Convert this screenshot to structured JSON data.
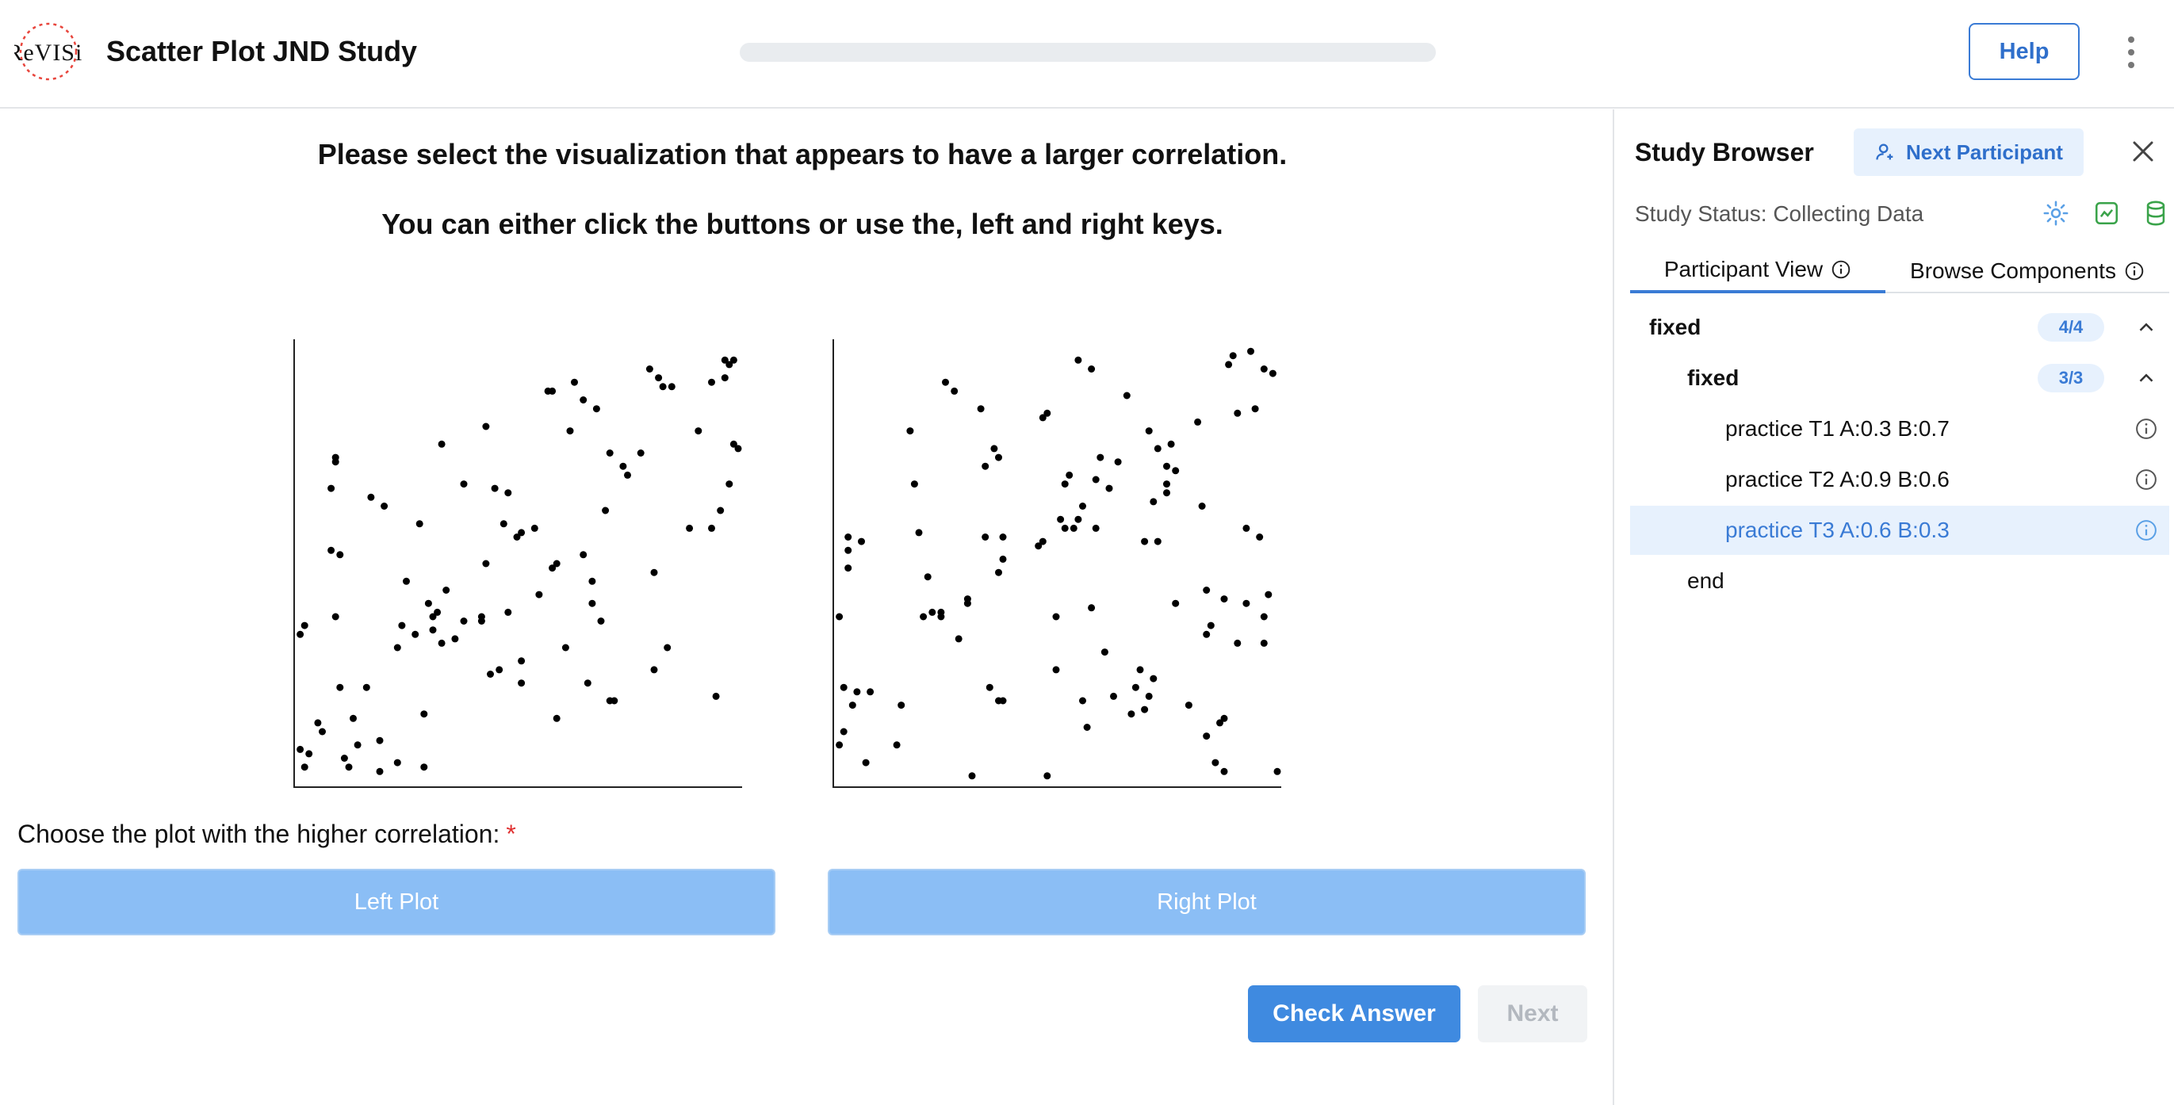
{
  "header": {
    "title": "Scatter Plot JND Study",
    "help_label": "Help",
    "progress": 0
  },
  "main": {
    "prompt_line1": "Please select the visualization that appears to have a larger correlation.",
    "prompt_line2": "You can either click the buttons or use the, left and right keys.",
    "question": "Choose the plot with the higher correlation:",
    "required_mark": "*",
    "left_choice_label": "Left Plot",
    "right_choice_label": "Right Plot",
    "check_answer_label": "Check Answer",
    "next_label": "Next"
  },
  "chart_data": [
    {
      "type": "scatter",
      "name": "",
      "xlim": [
        0,
        1
      ],
      "ylim": [
        0,
        1
      ],
      "grid": false,
      "points": [
        [
          0.01,
          0.34
        ],
        [
          0.02,
          0.36
        ],
        [
          0.01,
          0.08
        ],
        [
          0.03,
          0.07
        ],
        [
          0.02,
          0.04
        ],
        [
          0.05,
          0.14
        ],
        [
          0.06,
          0.12
        ],
        [
          0.08,
          0.53
        ],
        [
          0.09,
          0.73
        ],
        [
          0.08,
          0.67
        ],
        [
          0.09,
          0.74
        ],
        [
          0.1,
          0.52
        ],
        [
          0.09,
          0.38
        ],
        [
          0.1,
          0.22
        ],
        [
          0.12,
          0.04
        ],
        [
          0.11,
          0.06
        ],
        [
          0.13,
          0.15
        ],
        [
          0.14,
          0.09
        ],
        [
          0.16,
          0.22
        ],
        [
          0.17,
          0.65
        ],
        [
          0.19,
          0.1
        ],
        [
          0.2,
          0.63
        ],
        [
          0.19,
          0.03
        ],
        [
          0.23,
          0.31
        ],
        [
          0.25,
          0.46
        ],
        [
          0.23,
          0.05
        ],
        [
          0.24,
          0.36
        ],
        [
          0.28,
          0.59
        ],
        [
          0.29,
          0.04
        ],
        [
          0.29,
          0.16
        ],
        [
          0.27,
          0.34
        ],
        [
          0.31,
          0.35
        ],
        [
          0.3,
          0.41
        ],
        [
          0.31,
          0.38
        ],
        [
          0.33,
          0.32
        ],
        [
          0.32,
          0.39
        ],
        [
          0.34,
          0.44
        ],
        [
          0.33,
          0.77
        ],
        [
          0.36,
          0.33
        ],
        [
          0.38,
          0.37
        ],
        [
          0.38,
          0.68
        ],
        [
          0.42,
          0.38
        ],
        [
          0.42,
          0.37
        ],
        [
          0.43,
          0.81
        ],
        [
          0.43,
          0.5
        ],
        [
          0.44,
          0.25
        ],
        [
          0.45,
          0.67
        ],
        [
          0.46,
          0.26
        ],
        [
          0.47,
          0.59
        ],
        [
          0.48,
          0.66
        ],
        [
          0.48,
          0.39
        ],
        [
          0.5,
          0.56
        ],
        [
          0.51,
          0.57
        ],
        [
          0.51,
          0.28
        ],
        [
          0.51,
          0.23
        ],
        [
          0.54,
          0.58
        ],
        [
          0.55,
          0.43
        ],
        [
          0.57,
          0.89
        ],
        [
          0.58,
          0.49
        ],
        [
          0.59,
          0.5
        ],
        [
          0.59,
          0.15
        ],
        [
          0.58,
          0.89
        ],
        [
          0.61,
          0.31
        ],
        [
          0.62,
          0.8
        ],
        [
          0.63,
          0.91
        ],
        [
          0.65,
          0.87
        ],
        [
          0.65,
          0.52
        ],
        [
          0.66,
          0.23
        ],
        [
          0.67,
          0.46
        ],
        [
          0.67,
          0.41
        ],
        [
          0.68,
          0.85
        ],
        [
          0.69,
          0.37
        ],
        [
          0.7,
          0.62
        ],
        [
          0.71,
          0.75
        ],
        [
          0.71,
          0.19
        ],
        [
          0.72,
          0.19
        ],
        [
          0.74,
          0.72
        ],
        [
          0.75,
          0.7
        ],
        [
          0.78,
          0.75
        ],
        [
          0.8,
          0.94
        ],
        [
          0.81,
          0.48
        ],
        [
          0.81,
          0.26
        ],
        [
          0.82,
          0.92
        ],
        [
          0.83,
          0.9
        ],
        [
          0.84,
          0.31
        ],
        [
          0.85,
          0.9
        ],
        [
          0.89,
          0.58
        ],
        [
          0.91,
          0.8
        ],
        [
          0.94,
          0.91
        ],
        [
          0.94,
          0.58
        ],
        [
          0.95,
          0.2
        ],
        [
          0.96,
          0.62
        ],
        [
          0.97,
          0.92
        ],
        [
          0.97,
          0.96
        ],
        [
          0.98,
          0.95
        ],
        [
          0.99,
          0.96
        ],
        [
          0.99,
          0.77
        ],
        [
          0.98,
          0.68
        ],
        [
          1,
          0.76
        ]
      ]
    },
    {
      "type": "scatter",
      "name": "",
      "xlim": [
        0,
        1
      ],
      "ylim": [
        0,
        1
      ],
      "grid": false,
      "points": [
        [
          0.01,
          0.09
        ],
        [
          0.01,
          0.38
        ],
        [
          0.02,
          0.12
        ],
        [
          0.02,
          0.22
        ],
        [
          0.03,
          0.56
        ],
        [
          0.03,
          0.49
        ],
        [
          0.03,
          0.53
        ],
        [
          0.04,
          0.18
        ],
        [
          0.05,
          0.21
        ],
        [
          0.06,
          0.55
        ],
        [
          0.07,
          0.05
        ],
        [
          0.08,
          0.21
        ],
        [
          0.15,
          0.18
        ],
        [
          0.14,
          0.09
        ],
        [
          0.17,
          0.8
        ],
        [
          0.18,
          0.68
        ],
        [
          0.19,
          0.57
        ],
        [
          0.2,
          0.38
        ],
        [
          0.21,
          0.47
        ],
        [
          0.22,
          0.39
        ],
        [
          0.24,
          0.39
        ],
        [
          0.24,
          0.38
        ],
        [
          0.25,
          0.91
        ],
        [
          0.27,
          0.89
        ],
        [
          0.28,
          0.33
        ],
        [
          0.3,
          0.42
        ],
        [
          0.3,
          0.41
        ],
        [
          0.31,
          0.02
        ],
        [
          0.33,
          0.85
        ],
        [
          0.34,
          0.56
        ],
        [
          0.34,
          0.72
        ],
        [
          0.35,
          0.22
        ],
        [
          0.36,
          0.76
        ],
        [
          0.37,
          0.19
        ],
        [
          0.37,
          0.48
        ],
        [
          0.38,
          0.56
        ],
        [
          0.37,
          0.74
        ],
        [
          0.38,
          0.19
        ],
        [
          0.38,
          0.51
        ],
        [
          0.46,
          0.54
        ],
        [
          0.47,
          0.55
        ],
        [
          0.47,
          0.83
        ],
        [
          0.48,
          0.84
        ],
        [
          0.48,
          0.02
        ],
        [
          0.5,
          0.26
        ],
        [
          0.5,
          0.38
        ],
        [
          0.51,
          0.6
        ],
        [
          0.52,
          0.68
        ],
        [
          0.52,
          0.58
        ],
        [
          0.53,
          0.7
        ],
        [
          0.54,
          0.58
        ],
        [
          0.55,
          0.96
        ],
        [
          0.55,
          0.6
        ],
        [
          0.56,
          0.63
        ],
        [
          0.56,
          0.19
        ],
        [
          0.57,
          0.13
        ],
        [
          0.58,
          0.94
        ],
        [
          0.58,
          0.4
        ],
        [
          0.59,
          0.58
        ],
        [
          0.59,
          0.69
        ],
        [
          0.6,
          0.74
        ],
        [
          0.61,
          0.3
        ],
        [
          0.62,
          0.67
        ],
        [
          0.64,
          0.73
        ],
        [
          0.63,
          0.2
        ],
        [
          0.66,
          0.88
        ],
        [
          0.67,
          0.16
        ],
        [
          0.68,
          0.22
        ],
        [
          0.69,
          0.26
        ],
        [
          0.7,
          0.17
        ],
        [
          0.7,
          0.55
        ],
        [
          0.71,
          0.2
        ],
        [
          0.72,
          0.24
        ],
        [
          0.72,
          0.64
        ],
        [
          0.71,
          0.8
        ],
        [
          0.73,
          0.76
        ],
        [
          0.73,
          0.55
        ],
        [
          0.75,
          0.68
        ],
        [
          0.75,
          0.72
        ],
        [
          0.76,
          0.77
        ],
        [
          0.77,
          0.71
        ],
        [
          0.75,
          0.66
        ],
        [
          0.77,
          0.41
        ],
        [
          0.8,
          0.18
        ],
        [
          0.82,
          0.82
        ],
        [
          0.83,
          0.63
        ],
        [
          0.84,
          0.44
        ],
        [
          0.84,
          0.34
        ],
        [
          0.85,
          0.36
        ],
        [
          0.84,
          0.11
        ],
        [
          0.86,
          0.05
        ],
        [
          0.88,
          0.15
        ],
        [
          0.88,
          0.42
        ],
        [
          0.87,
          0.14
        ],
        [
          0.88,
          0.03
        ],
        [
          0.89,
          0.95
        ],
        [
          0.9,
          0.97
        ],
        [
          0.91,
          0.84
        ],
        [
          0.91,
          0.32
        ],
        [
          0.93,
          0.41
        ],
        [
          0.93,
          0.58
        ],
        [
          0.95,
          0.85
        ],
        [
          0.96,
          0.56
        ],
        [
          0.94,
          0.98
        ],
        [
          0.97,
          0.38
        ],
        [
          0.97,
          0.32
        ],
        [
          0.97,
          0.94
        ],
        [
          0.99,
          0.93
        ],
        [
          0.98,
          0.43
        ],
        [
          1,
          0.03
        ]
      ]
    }
  ],
  "sidebar": {
    "title": "Study Browser",
    "next_participant_label": "Next Participant",
    "status_text": "Study Status: Collecting Data",
    "tabs": [
      {
        "label": "Participant View"
      },
      {
        "label": "Browse Components"
      }
    ],
    "tree": [
      {
        "label": "fixed",
        "badge": "4/4"
      },
      {
        "label": "fixed",
        "badge": "3/3"
      },
      {
        "label": "practice T1 A:0.3 B:0.7"
      },
      {
        "label": "practice T2 A:0.9 B:0.6"
      },
      {
        "label": "practice T3 A:0.6 B:0.3"
      },
      {
        "label": "end"
      }
    ]
  }
}
